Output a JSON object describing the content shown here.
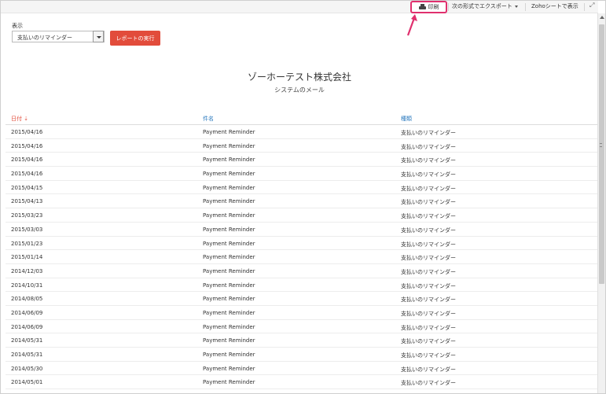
{
  "toolbar": {
    "print_label": "印刷",
    "export_label": "次の形式でエクスポート",
    "zoho_sheet_label": "Zohoシートで表示",
    "expand_icon": "expand-icon",
    "print_icon": "printer-icon"
  },
  "filter": {
    "label": "表示",
    "selected": "支払いのリマインダー",
    "run_button": "レポートの実行"
  },
  "report": {
    "company": "ゾーホーテスト株式会社",
    "subtitle": "システムのメール"
  },
  "table": {
    "columns": [
      "日付",
      "件名",
      "種類"
    ],
    "sort_indicator": "⇣",
    "rows": [
      {
        "date": "2015/04/16",
        "subject": "Payment Reminder",
        "type": "支払いのリマインダー"
      },
      {
        "date": "2015/04/16",
        "subject": "Payment Reminder",
        "type": "支払いのリマインダー"
      },
      {
        "date": "2015/04/16",
        "subject": "Payment Reminder",
        "type": "支払いのリマインダー"
      },
      {
        "date": "2015/04/16",
        "subject": "Payment Reminder",
        "type": "支払いのリマインダー"
      },
      {
        "date": "2015/04/15",
        "subject": "Payment Reminder",
        "type": "支払いのリマインダー"
      },
      {
        "date": "2015/04/13",
        "subject": "Payment Reminder",
        "type": "支払いのリマインダー"
      },
      {
        "date": "2015/03/23",
        "subject": "Payment Reminder",
        "type": "支払いのリマインダー"
      },
      {
        "date": "2015/03/03",
        "subject": "Payment Reminder",
        "type": "支払いのリマインダー"
      },
      {
        "date": "2015/01/23",
        "subject": "Payment Reminder",
        "type": "支払いのリマインダー"
      },
      {
        "date": "2015/01/14",
        "subject": "Payment Reminder",
        "type": "支払いのリマインダー"
      },
      {
        "date": "2014/12/03",
        "subject": "Payment Reminder",
        "type": "支払いのリマインダー"
      },
      {
        "date": "2014/10/31",
        "subject": "Payment Reminder",
        "type": "支払いのリマインダー"
      },
      {
        "date": "2014/08/05",
        "subject": "Payment Reminder",
        "type": "支払いのリマインダー"
      },
      {
        "date": "2014/06/09",
        "subject": "Payment Reminder",
        "type": "支払いのリマインダー"
      },
      {
        "date": "2014/06/09",
        "subject": "Payment Reminder",
        "type": "支払いのリマインダー"
      },
      {
        "date": "2014/05/31",
        "subject": "Payment Reminder",
        "type": "支払いのリマインダー"
      },
      {
        "date": "2014/05/31",
        "subject": "Payment Reminder",
        "type": "支払いのリマインダー"
      },
      {
        "date": "2014/05/30",
        "subject": "Payment Reminder",
        "type": "支払いのリマインダー"
      },
      {
        "date": "2014/05/01",
        "subject": "Payment Reminder",
        "type": "支払いのリマインダー"
      }
    ]
  },
  "colors": {
    "accent": "#e24c3b",
    "highlight": "#e0306e",
    "link": "#2d7bbf"
  }
}
